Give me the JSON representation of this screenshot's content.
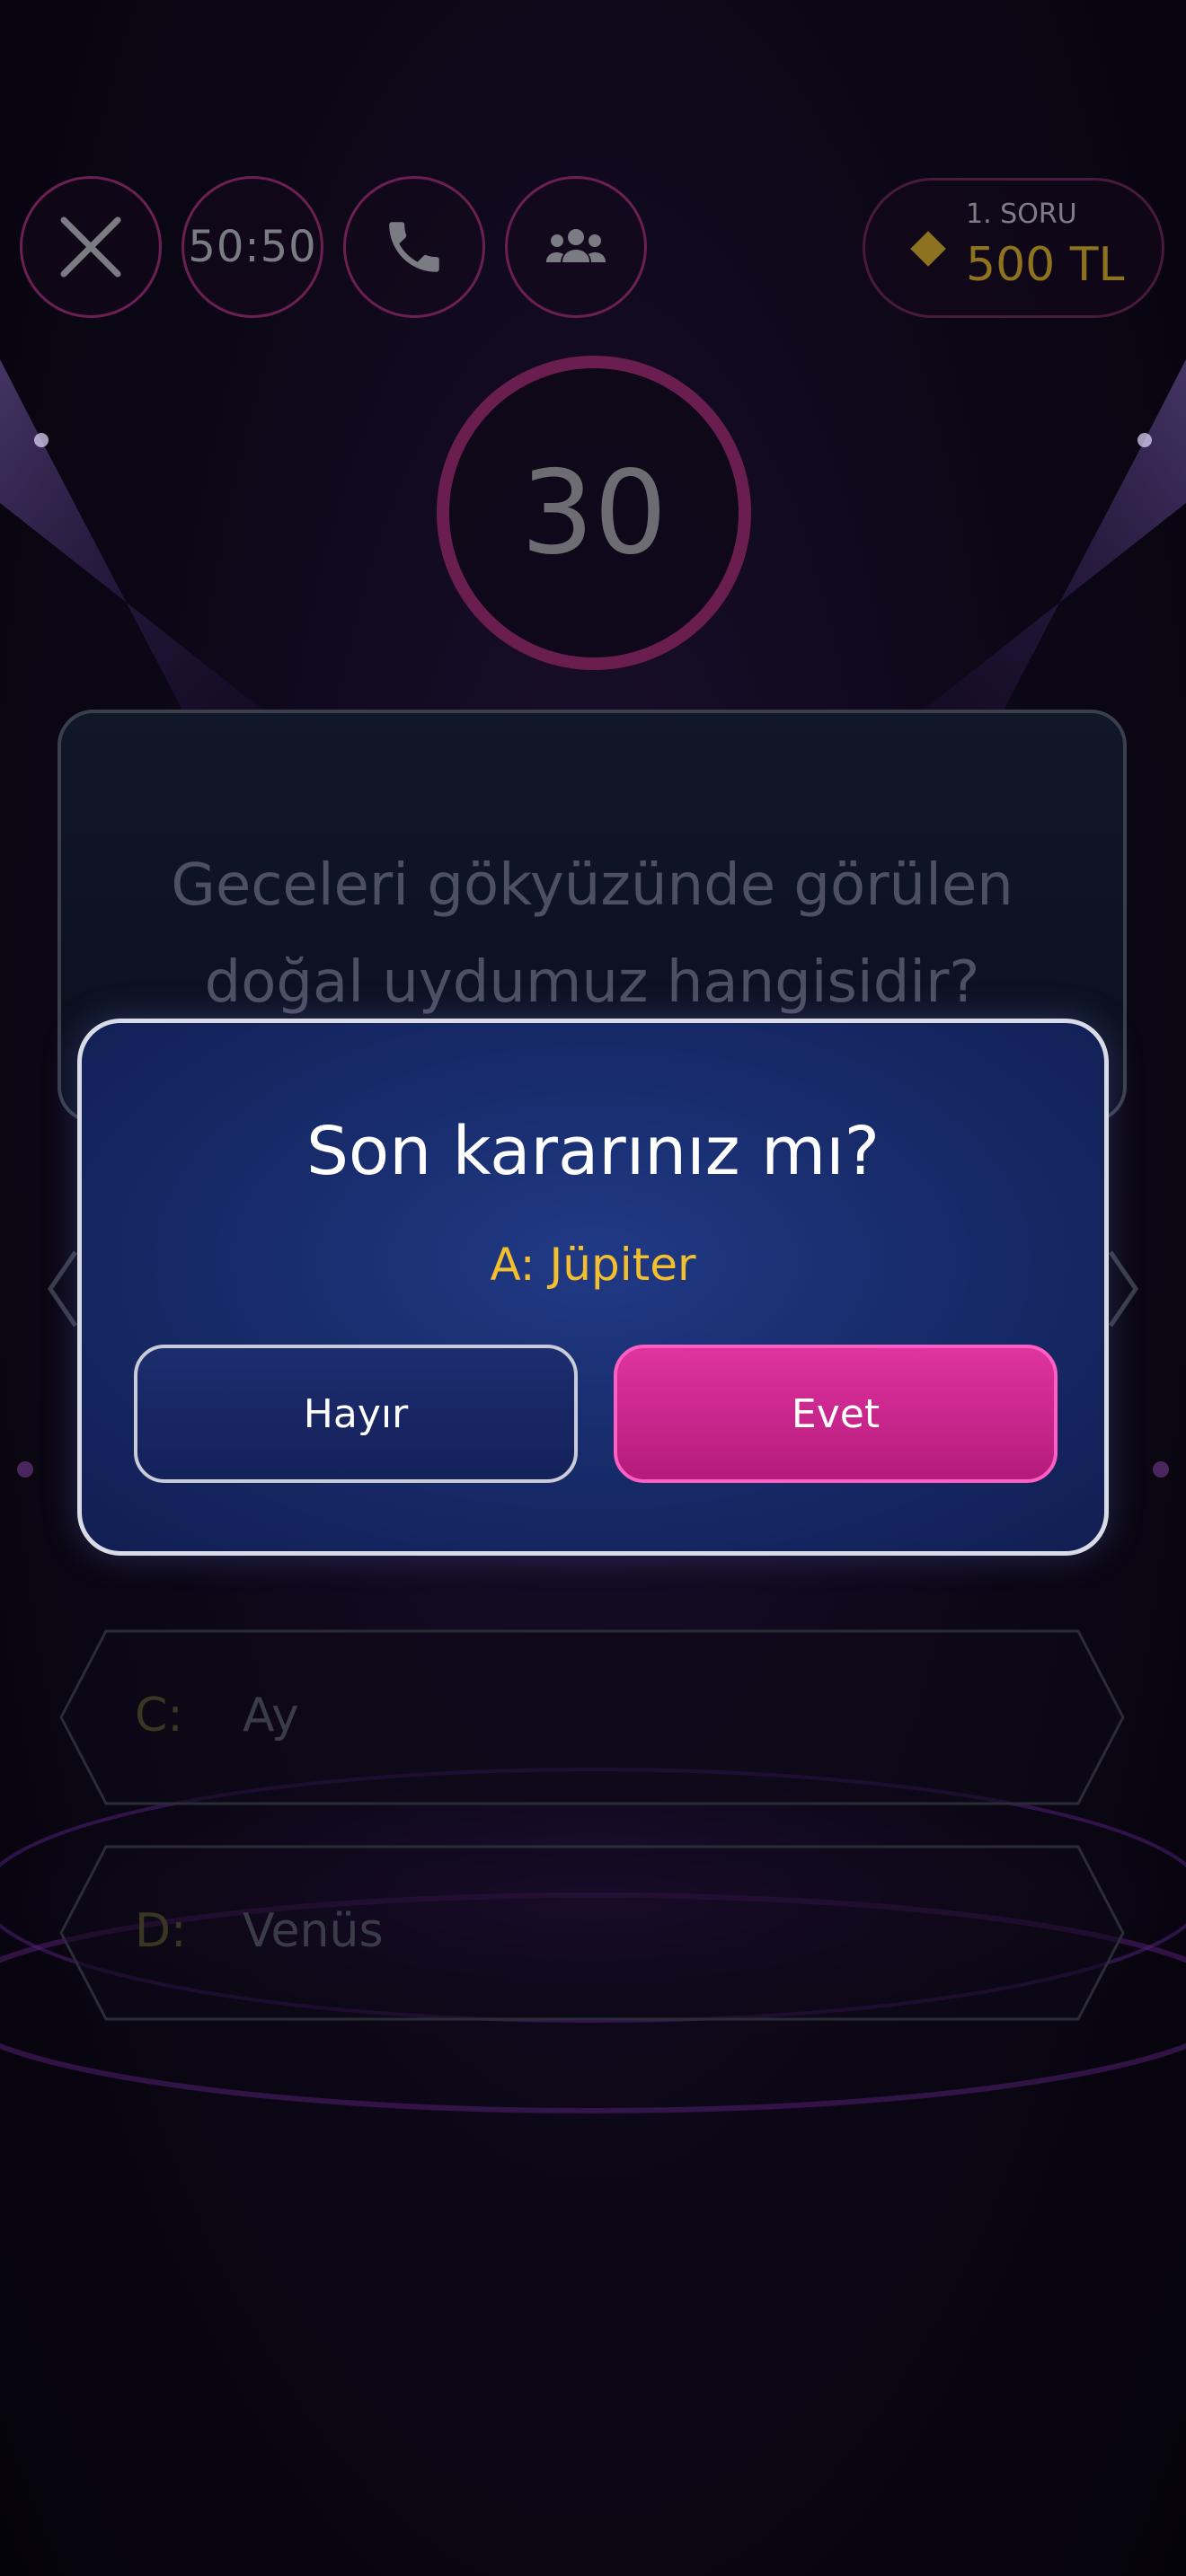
{
  "top_bar": {
    "close_icon": "close-icon",
    "fifty_fifty_label": "50:50",
    "phone_icon": "phone-icon",
    "audience_icon": "audience-icon",
    "prize": {
      "label": "1. SORU",
      "value": "500 TL",
      "icon": "diamond-icon"
    }
  },
  "timer": {
    "value": "30"
  },
  "question": {
    "text": "Geceleri gökyüzünde görülen doğal uydumuz hangisidir?"
  },
  "answers": [
    {
      "letter": "C:",
      "text": "Ay"
    },
    {
      "letter": "D:",
      "text": "Venüs"
    }
  ],
  "dialog": {
    "title": "Son kararınız mı?",
    "selected_answer": "A: Jüpiter",
    "no_label": "Hayır",
    "yes_label": "Evet"
  },
  "colors": {
    "accent_pink": "#e0339f",
    "gold": "#f3bf2c",
    "modal_blue": "#182c6c"
  }
}
